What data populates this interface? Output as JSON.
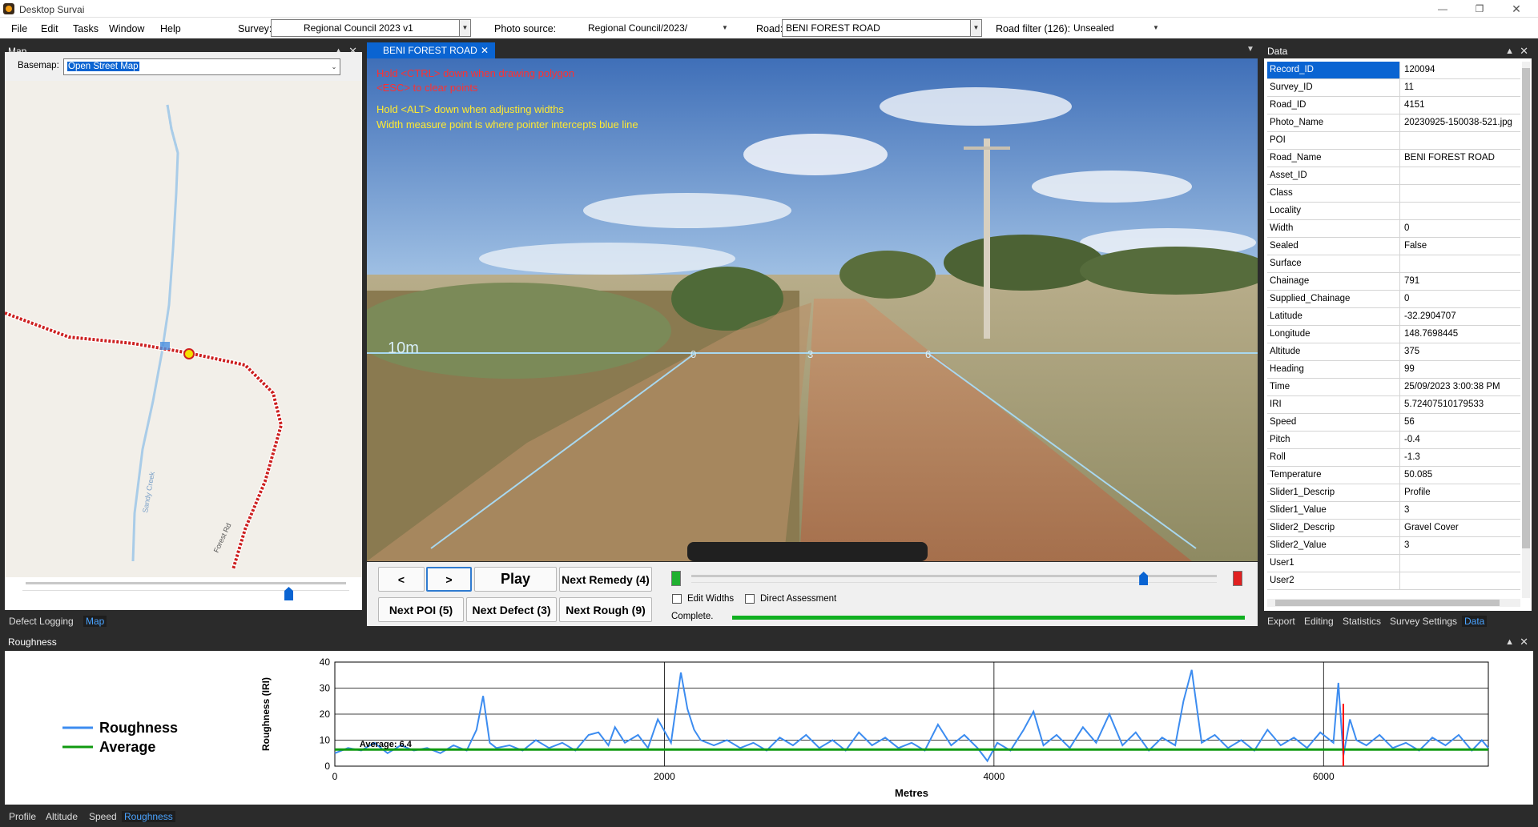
{
  "app": {
    "title": "Desktop Survai"
  },
  "menu": [
    "File",
    "Edit",
    "Tasks",
    "Window",
    "Help"
  ],
  "toolbar": {
    "survey_label": "Survey:",
    "survey_value": "Regional Council 2023 v1",
    "photo_label": "Photo source:",
    "photo_value": "Regional Council/2023/",
    "road_label": "Road:",
    "road_value": "BENI FOREST ROAD",
    "filter_label": "Road filter (126):",
    "filter_value": "Unsealed"
  },
  "map_panel": {
    "title": "Map",
    "basemap_label": "Basemap:",
    "basemap_value": "Open Street Map",
    "creek_label": "Sandy Creek",
    "road_label": "Forest Rd",
    "slider_value": 0.82,
    "tabs": [
      "Defect Logging",
      "Map"
    ]
  },
  "photo_panel": {
    "tab": "BENI FOREST ROAD",
    "hint1": "Hold <CTRL> down when drawing polygon",
    "hint2": "<ESC> to clear points",
    "hint3": "Hold <ALT> down when adjusting widths",
    "hint4": "Width measure point is where pointer intercepts blue line",
    "scale_label": "10m",
    "width_ticks": [
      "0",
      "3",
      "6"
    ]
  },
  "controls": {
    "prev": "<",
    "next": ">",
    "play": "Play",
    "next_remedy": "Next Remedy (4)",
    "next_poi": "Next POI (5)",
    "next_defect": "Next Defect (3)",
    "next_rough": "Next Rough (9)",
    "edit_widths": "Edit Widths",
    "direct_assessment": "Direct Assessment",
    "status": "Complete.",
    "slider_value": 0.86,
    "progress": 1.0
  },
  "data_panel": {
    "title": "Data",
    "rows": [
      [
        "Record_ID",
        "120094"
      ],
      [
        "Survey_ID",
        "11"
      ],
      [
        "Road_ID",
        "4151"
      ],
      [
        "Photo_Name",
        "20230925-150038-521.jpg"
      ],
      [
        "POI",
        ""
      ],
      [
        "Road_Name",
        "BENI FOREST ROAD"
      ],
      [
        "Asset_ID",
        ""
      ],
      [
        "Class",
        ""
      ],
      [
        "Locality",
        ""
      ],
      [
        "Width",
        "0"
      ],
      [
        "Sealed",
        "False"
      ],
      [
        "Surface",
        ""
      ],
      [
        "Chainage",
        "791"
      ],
      [
        "Supplied_Chainage",
        "0"
      ],
      [
        "Latitude",
        "-32.2904707"
      ],
      [
        "Longitude",
        "148.7698445"
      ],
      [
        "Altitude",
        "375"
      ],
      [
        "Heading",
        "99"
      ],
      [
        "Time",
        "25/09/2023 3:00:38 PM"
      ],
      [
        "IRI",
        "5.72407510179533"
      ],
      [
        "Speed",
        "56"
      ],
      [
        "Pitch",
        "-0.4"
      ],
      [
        "Roll",
        "-1.3"
      ],
      [
        "Temperature",
        "50.085"
      ],
      [
        "Slider1_Descrip",
        "Profile"
      ],
      [
        "Slider1_Value",
        "3"
      ],
      [
        "Slider2_Descrip",
        "Gravel Cover"
      ],
      [
        "Slider2_Value",
        "3"
      ],
      [
        "User1",
        ""
      ],
      [
        "User2",
        ""
      ]
    ],
    "tabs": [
      "Export",
      "Editing",
      "Statistics",
      "Survey Settings",
      "Data"
    ]
  },
  "rough_panel": {
    "title": "Roughness",
    "tabs": [
      "Profile",
      "Altitude",
      "Speed",
      "Roughness"
    ]
  },
  "colors": {
    "roughness": "#3c8cf0",
    "average": "#109a10",
    "cursor": "#ff0000",
    "selection": "#0a64d2",
    "panel_bg": "#2b2b2b"
  },
  "chart_data": {
    "type": "line",
    "xlabel": "Metres",
    "ylabel": "Roughness (IRI)",
    "xlim": [
      0,
      7000
    ],
    "ylim": [
      0,
      40
    ],
    "xticks": [
      0,
      2000,
      4000,
      6000
    ],
    "yticks": [
      0,
      10,
      20,
      30,
      40
    ],
    "grid": true,
    "legend": "left",
    "average_label": "Average: 6.4",
    "average": 6.4,
    "cursor_x": 6120,
    "series": [
      {
        "name": "Roughness",
        "color": "#3c8cf0",
        "x": [
          0,
          80,
          160,
          240,
          320,
          400,
          480,
          560,
          640,
          720,
          800,
          860,
          900,
          940,
          980,
          1060,
          1140,
          1220,
          1300,
          1380,
          1460,
          1540,
          1600,
          1660,
          1700,
          1760,
          1840,
          1900,
          1960,
          2040,
          2100,
          2140,
          2180,
          2220,
          2300,
          2380,
          2460,
          2540,
          2620,
          2700,
          2780,
          2860,
          2940,
          3020,
          3100,
          3180,
          3260,
          3340,
          3420,
          3500,
          3580,
          3660,
          3740,
          3820,
          3900,
          3960,
          4020,
          4100,
          4180,
          4240,
          4300,
          4380,
          4460,
          4540,
          4620,
          4700,
          4780,
          4860,
          4940,
          5020,
          5100,
          5150,
          5200,
          5260,
          5340,
          5420,
          5500,
          5580,
          5660,
          5740,
          5820,
          5900,
          5980,
          6060,
          6090,
          6120,
          6160,
          6200,
          6260,
          6340,
          6420,
          6500,
          6580,
          6660,
          6740,
          6820,
          6900,
          6960,
          7000
        ],
        "y": [
          5,
          7,
          6,
          9,
          5,
          8,
          6,
          7,
          5,
          8,
          6,
          14,
          27,
          9,
          7,
          8,
          6,
          10,
          7,
          9,
          6,
          12,
          13,
          8,
          15,
          9,
          12,
          7,
          18,
          9,
          36,
          22,
          14,
          10,
          8,
          10,
          7,
          9,
          6,
          11,
          8,
          12,
          7,
          10,
          6,
          13,
          8,
          11,
          7,
          9,
          6,
          16,
          8,
          12,
          7,
          2,
          9,
          6,
          14,
          21,
          8,
          12,
          7,
          15,
          9,
          20,
          8,
          13,
          6,
          11,
          8,
          25,
          37,
          9,
          12,
          7,
          10,
          6,
          14,
          8,
          11,
          7,
          13,
          9,
          32,
          4,
          18,
          10,
          8,
          12,
          7,
          9,
          6,
          11,
          8,
          12,
          6,
          10,
          7
        ]
      },
      {
        "name": "Average",
        "color": "#109a10",
        "x": [
          0,
          7000
        ],
        "y": [
          6.4,
          6.4
        ]
      }
    ]
  }
}
